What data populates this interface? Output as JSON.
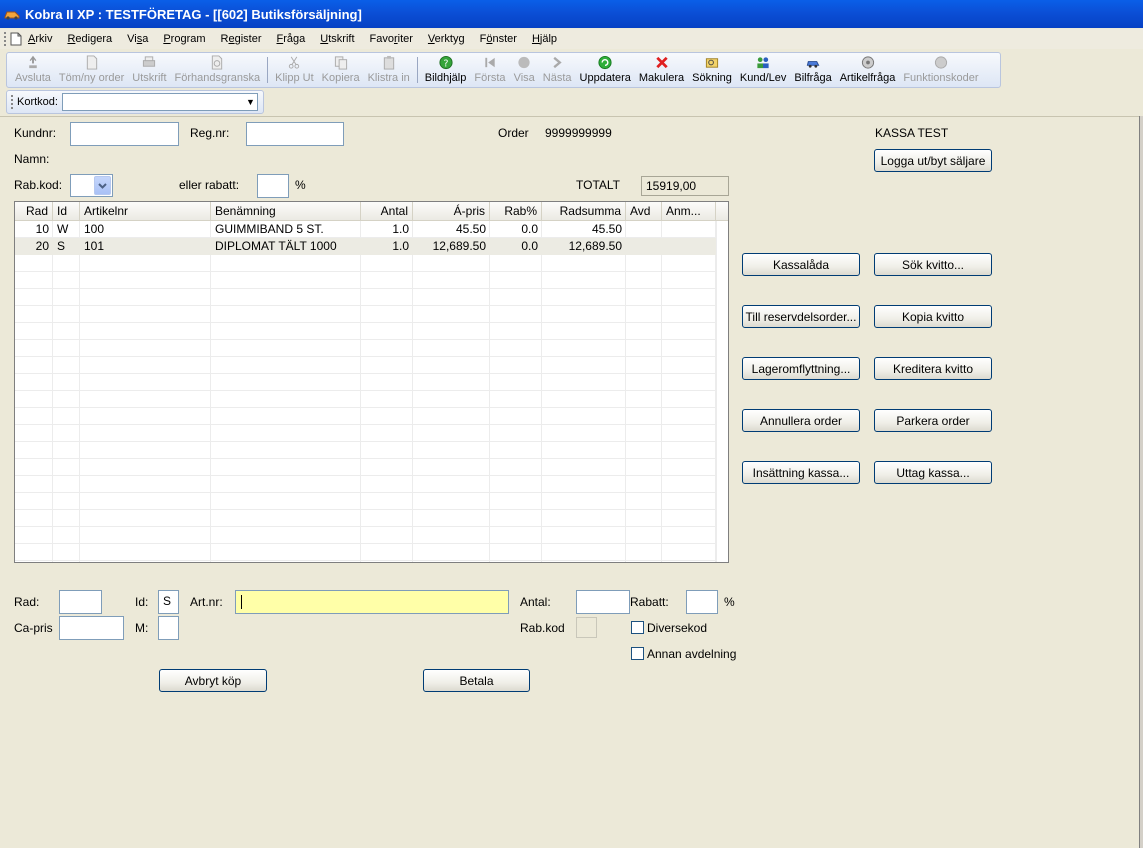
{
  "window": {
    "title": "Kobra II XP : TESTFÖRETAG - [[602] Butiksförsäljning]"
  },
  "menu": [
    {
      "pre": "",
      "u": "A",
      "post": "rkiv"
    },
    {
      "pre": "",
      "u": "R",
      "post": "edigera"
    },
    {
      "pre": "Vi",
      "u": "s",
      "post": "a"
    },
    {
      "pre": "",
      "u": "P",
      "post": "rogram"
    },
    {
      "pre": "R",
      "u": "e",
      "post": "gister"
    },
    {
      "pre": "",
      "u": "F",
      "post": "råga"
    },
    {
      "pre": "",
      "u": "U",
      "post": "tskrift"
    },
    {
      "pre": "Favo",
      "u": "r",
      "post": "iter"
    },
    {
      "pre": "",
      "u": "V",
      "post": "erktyg"
    },
    {
      "pre": "F",
      "u": "ö",
      "post": "nster"
    },
    {
      "pre": "",
      "u": "H",
      "post": "jälp"
    }
  ],
  "toolbar": [
    {
      "label": "Avsluta",
      "icon": "exit-icon",
      "enabled": false
    },
    {
      "label": "Töm/ny order",
      "icon": "new-document-icon",
      "enabled": false
    },
    {
      "label": "Utskrift",
      "icon": "print-icon",
      "enabled": false
    },
    {
      "label": "Förhandsgranska",
      "icon": "preview-icon",
      "enabled": false
    },
    {
      "sep": true
    },
    {
      "label": "Klipp Ut",
      "icon": "scissors-icon",
      "enabled": false
    },
    {
      "label": "Kopiera",
      "icon": "copy-icon",
      "enabled": false
    },
    {
      "label": "Klistra in",
      "icon": "paste-icon",
      "enabled": false
    },
    {
      "sep": true
    },
    {
      "label": "Bildhjälp",
      "icon": "help-icon",
      "enabled": true
    },
    {
      "label": "Första",
      "icon": "first-icon",
      "enabled": false
    },
    {
      "label": "Visa",
      "icon": "show-icon",
      "enabled": false
    },
    {
      "label": "Nästa",
      "icon": "next-icon",
      "enabled": false
    },
    {
      "label": "Uppdatera",
      "icon": "refresh-icon",
      "enabled": true
    },
    {
      "label": "Makulera",
      "icon": "delete-icon",
      "enabled": true
    },
    {
      "label": "Sökning",
      "icon": "search-icon",
      "enabled": true
    },
    {
      "label": "Kund/Lev",
      "icon": "customers-icon",
      "enabled": true
    },
    {
      "label": "Bilfråga",
      "icon": "car-icon",
      "enabled": true
    },
    {
      "label": "Artikelfråga",
      "icon": "article-icon",
      "enabled": true
    },
    {
      "label": "Funktionskoder",
      "icon": "function-icon",
      "enabled": false
    }
  ],
  "kortkod": {
    "label": "Kortkod:",
    "value": ""
  },
  "header": {
    "kundnr_label": "Kundnr:",
    "kundnr_value": "",
    "regnr_label": "Reg.nr:",
    "regnr_value": "",
    "order_label": "Order",
    "order_value": "9999999999",
    "kassa_label": "KASSA TEST",
    "logout_button": "Logga ut/byt säljare",
    "namn_label": "Namn:",
    "rabkod_label": "Rab.kod:",
    "eller_rabatt_label": "eller rabatt:",
    "rabatt_value": "",
    "percent": "%",
    "totalt_label": "TOTALT",
    "totalt_value": "15919,00"
  },
  "grid": {
    "columns": [
      "Rad",
      "Id",
      "Artikelnr",
      "Benämning",
      "Antal",
      "Á-pris",
      "Rab%",
      "Radsumma",
      "Avd",
      "Anm..."
    ],
    "rows": [
      [
        "10",
        "W",
        "100",
        "GUIMMIBAND 5 ST.",
        "1.0",
        "45.50",
        "0.0",
        "45.50",
        "",
        ""
      ],
      [
        "20",
        "S",
        "101",
        "DIPLOMAT TÄLT 1000",
        "1.0",
        "12,689.50",
        "0.0",
        "12,689.50",
        "",
        ""
      ]
    ]
  },
  "side_buttons": [
    [
      "Kassalåda",
      "Sök kvitto..."
    ],
    [
      "Till reservdelsorder...",
      "Kopia kvitto"
    ],
    [
      "Lageromflyttning...",
      "Kreditera kvitto"
    ],
    [
      "Annullera order",
      "Parkera order"
    ],
    [
      "Insättning kassa...",
      "Uttag kassa..."
    ]
  ],
  "entry": {
    "rad_label": "Rad:",
    "rad_value": "",
    "id_label": "Id:",
    "id_value": "S",
    "artnr_label": "Art.nr:",
    "artnr_value": "",
    "antal_label": "Antal:",
    "antal_value": "",
    "rabatt_label": "Rabatt:",
    "rabatt_value": "",
    "percent": "%",
    "capris_label": "Ca-pris",
    "capris_value": "",
    "m_label": "M:",
    "m_value": "",
    "rabkod_label": "Rab.kod",
    "diversekod_label": "Diversekod",
    "annan_avdelning_label": "Annan avdelning"
  },
  "footer_buttons": {
    "avbryt": "Avbryt köp",
    "betala": "Betala"
  }
}
